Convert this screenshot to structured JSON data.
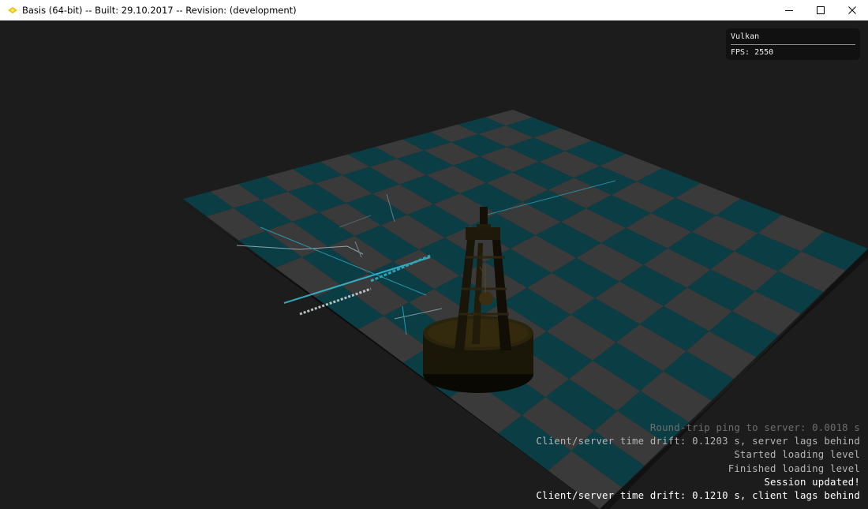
{
  "window": {
    "title": "Basis (64-bit) -- Built: 29.10.2017 -- Revision: (development)",
    "icon": "basis-logo-icon",
    "controls": [
      "minimize-icon",
      "maximize-icon",
      "close-icon"
    ]
  },
  "overlay": {
    "renderer": "Vulkan",
    "fps_text": "FPS: 2550"
  },
  "console": {
    "lines": [
      "Round-trip ping to server: 0.0018 s",
      "Client/server time drift: 0.1203 s, server lags behind",
      "Started loading level",
      "Finished loading level",
      "Session updated!",
      "Client/server time drift: 0.1210 s, client lags behind"
    ]
  },
  "scene": {
    "background_color": "#1c1c1c",
    "board_dark_color": "#0a3e44",
    "board_light_color": "#3a3a3a",
    "board_rows": 10,
    "board_cols": 12,
    "object": "buoy"
  }
}
